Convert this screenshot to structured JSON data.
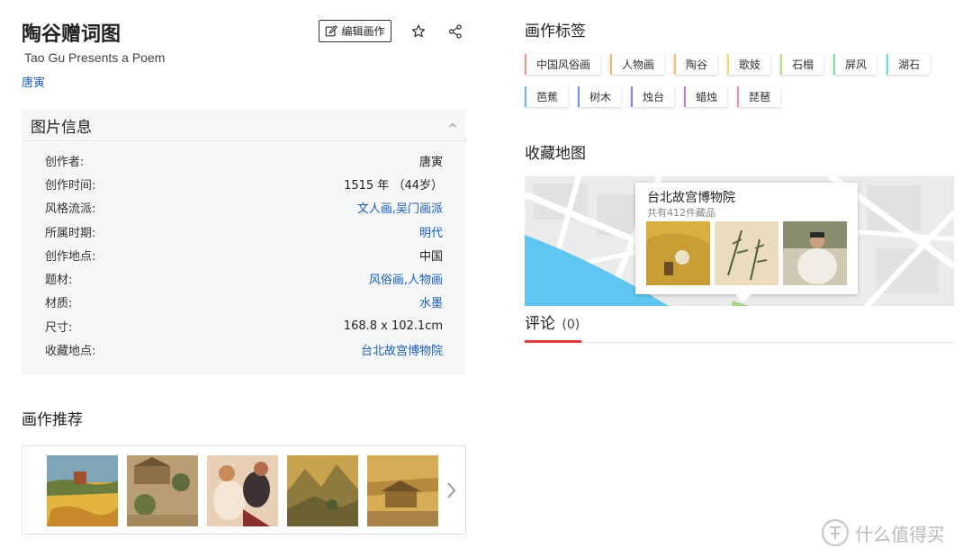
{
  "artwork": {
    "title": "陶谷赠词图",
    "english_title": "Tao Gu Presents a Poem",
    "artist": "唐寅",
    "edit_label": "编辑画作"
  },
  "info_panel": {
    "header": "图片信息",
    "rows": [
      {
        "label": "创作者:",
        "value": "唐寅"
      },
      {
        "label": "创作时间:",
        "value": "1515 年 （44岁）"
      },
      {
        "label": "风格流派:",
        "value": "文人画,吴门画派"
      },
      {
        "label": "所属时期:",
        "value": "明代"
      },
      {
        "label": "创作地点:",
        "value": "中国"
      },
      {
        "label": "题材:",
        "value": "风俗画,人物画"
      },
      {
        "label": "材质:",
        "value": "水墨"
      },
      {
        "label": "尺寸:",
        "value": "168.8 x 102.1cm"
      },
      {
        "label": "收藏地点:",
        "value": "台北故宫博物院"
      }
    ]
  },
  "recommend": {
    "title": "画作推荐",
    "thumbs": [
      "harvest-painting",
      "village-painting",
      "figures-painting",
      "landscape-painting",
      "pavilion-painting"
    ]
  },
  "tags": {
    "title": "画作标签",
    "items": [
      {
        "label": "中国风俗画",
        "color": "#f08f8f"
      },
      {
        "label": "人物画",
        "color": "#f3b07a"
      },
      {
        "label": "陶谷",
        "color": "#f2c36b"
      },
      {
        "label": "歌妓",
        "color": "#eedb6f"
      },
      {
        "label": "石榻",
        "color": "#b6e07d"
      },
      {
        "label": "屏风",
        "color": "#7fd9a7"
      },
      {
        "label": "湖石",
        "color": "#6fd3d6"
      },
      {
        "label": "芭蕉",
        "color": "#6fb4ea"
      },
      {
        "label": "树木",
        "color": "#7a8fe3"
      },
      {
        "label": "烛台",
        "color": "#8f7ae6"
      },
      {
        "label": "蜡烛",
        "color": "#bd7ae0"
      },
      {
        "label": "琵琶",
        "color": "#ef8fab"
      }
    ]
  },
  "map": {
    "title": "收藏地图",
    "museum": "台北故宫博物院",
    "count_text": "共有412件藏品"
  },
  "comments": {
    "label": "评论",
    "count": "(0)"
  },
  "watermark": {
    "text": "什么值得买"
  }
}
